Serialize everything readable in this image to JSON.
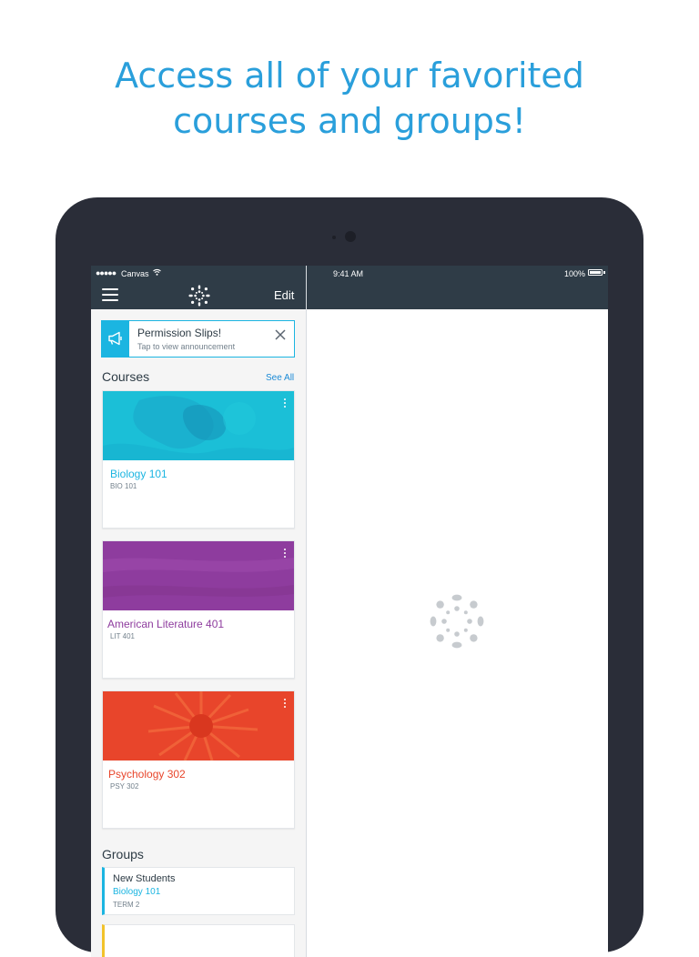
{
  "headline": {
    "line1": "Access all of your favorited",
    "line2": "courses and groups!"
  },
  "colors": {
    "headline": "#2a9fdb",
    "navbar": "#2f3c47",
    "accent_blue": "#1bb5e1",
    "biology": "#1bb5e1",
    "literature": "#8e3c9e",
    "psychology": "#e8452b"
  },
  "statusbar": {
    "signal": "●●●●●",
    "carrier": "Canvas",
    "time": "9:41 AM",
    "battery": "100%"
  },
  "navbar": {
    "menu_icon": "hamburger-icon",
    "logo_icon": "canvas-logo-icon",
    "edit_label": "Edit"
  },
  "announcement": {
    "icon": "megaphone-icon",
    "title": "Permission Slips!",
    "subtitle": "Tap to view announcement"
  },
  "courses": {
    "title": "Courses",
    "see_all": "See All",
    "items": [
      {
        "name": "Biology 101",
        "code": "BIO 101",
        "color": "#1bb5e1"
      },
      {
        "name": "American Literature 401",
        "code": "LIT 401",
        "color": "#8e3c9e"
      },
      {
        "name": "Psychology 302",
        "code": "PSY 302",
        "color": "#e8452b"
      }
    ]
  },
  "groups": {
    "title": "Groups",
    "items": [
      {
        "name": "New Students",
        "course": "Biology 101",
        "term": "TERM 2"
      }
    ]
  },
  "detail": {
    "loading_icon": "canvas-loading-icon"
  }
}
